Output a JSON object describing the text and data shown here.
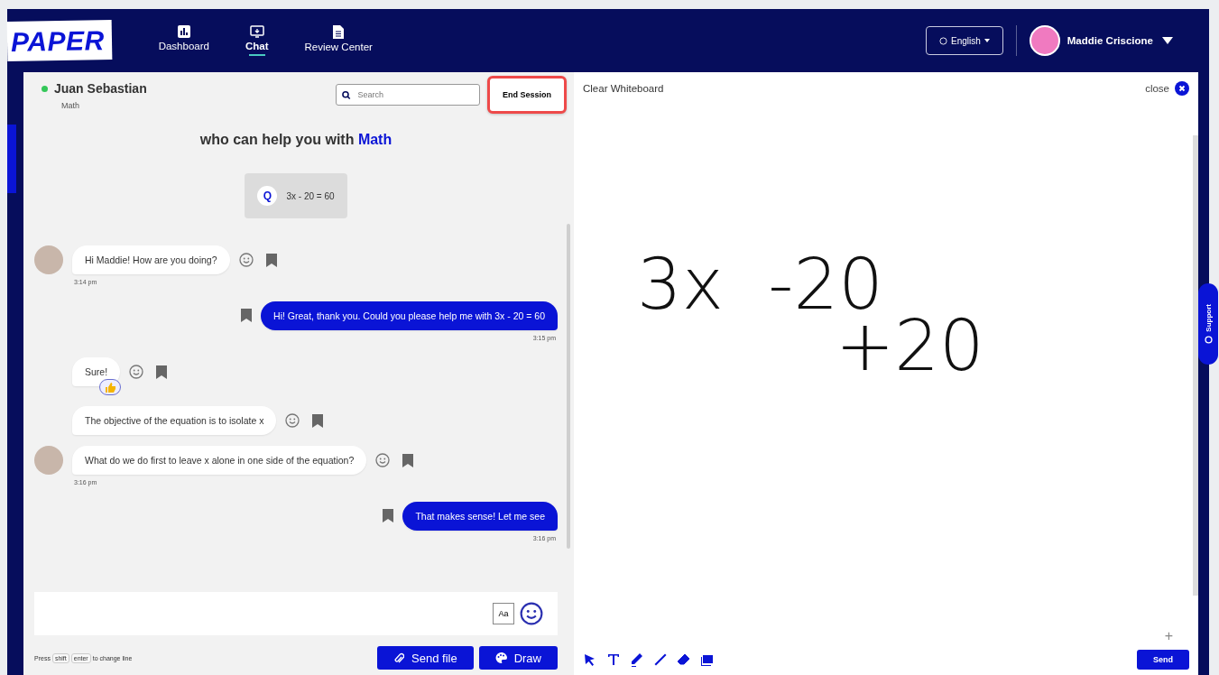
{
  "header": {
    "logo": "PAPER",
    "nav": [
      {
        "label": "Dashboard",
        "selected": false
      },
      {
        "label": "Chat",
        "selected": true
      },
      {
        "label": "Review Center",
        "selected": false
      }
    ],
    "language": "English",
    "user": "Maddie Criscione"
  },
  "chat": {
    "contact": {
      "name": "Juan Sebastian",
      "online": true,
      "subject": "Math"
    },
    "search": {
      "placeholder": "Search"
    },
    "end_session": "End Session",
    "intro": "who can help you with **Math**",
    "question": {
      "badge": "Q",
      "text": "3x - 20 = 60"
    },
    "messages": [
      {
        "kind": "incoming",
        "text": "Hi Maddie! How are you doing?",
        "avatar": true,
        "time": "3:14 pm",
        "reaction": false
      },
      {
        "kind": "outgoing",
        "text": "Hi! Great, thank you. Could you please help me with 3x - 20 = 60",
        "time": "3:15 pm"
      },
      {
        "kind": "incoming",
        "text": "Sure!",
        "avatar": false,
        "reaction": true
      },
      {
        "kind": "incoming",
        "text": "The objective of the equation is to isolate x",
        "avatar": false,
        "reaction": false
      },
      {
        "kind": "incoming",
        "text": "What do we do first to leave x alone in one side of the equation?",
        "avatar": true,
        "time": "3:16 pm",
        "reaction": false
      },
      {
        "kind": "outgoing",
        "text": "That makes sense! Let me see",
        "time": "3:16 pm"
      }
    ],
    "format_button": "Aa",
    "hint": {
      "before": "Press",
      "keys": [
        "shift",
        "enter"
      ],
      "after": "to change line"
    },
    "buttons": [
      "Send file",
      "Draw"
    ]
  },
  "whiteboard": {
    "clear": "Clear Whiteboard",
    "close": "close",
    "ink_lines": [
      "3x  -20",
      "+20"
    ],
    "zoom": "+",
    "send": "Send",
    "support": "Support"
  }
}
